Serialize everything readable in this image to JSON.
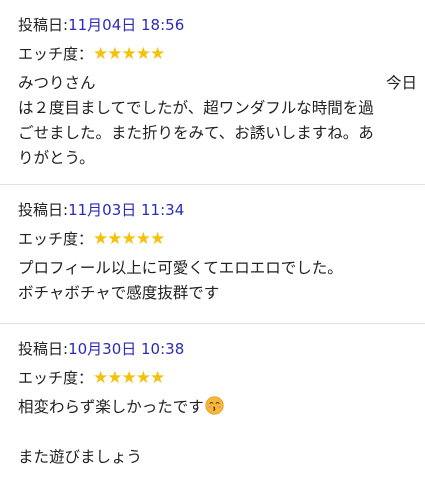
{
  "reviews": [
    {
      "posted_label": "投稿日:",
      "posted_date": "11月04日 18:56",
      "rating_label": "エッチ度：",
      "rating_stars": "★★★★★",
      "rating_value": 5,
      "rating_max": 5,
      "name": "みつりさん",
      "first_word": "今日",
      "lines": [
        "は２度目ましてでしたが、超ワンダフルな時間を過",
        "ごせました。また折りをみて、お誘いしますね。あ",
        "りがとう。"
      ]
    },
    {
      "posted_label": "投稿日:",
      "posted_date": "11月03日 11:34",
      "rating_label": "エッチ度：",
      "rating_stars": "★★★★★",
      "rating_value": 5,
      "rating_max": 5,
      "lines": [
        "プロフィール以上に可愛くてエロエロでした。",
        "ボチャボチャで感度抜群です"
      ]
    },
    {
      "posted_label": "投稿日:",
      "posted_date": "10月30日 10:38",
      "rating_label": "エッチ度：",
      "rating_stars": "★★★★★",
      "rating_value": 5,
      "rating_max": 5,
      "lines": [
        "相変わらず楽しかったです",
        "また遊びましょう"
      ],
      "emoji": "kissing-face-icon"
    }
  ],
  "colors": {
    "date": "#2b2bb8",
    "stars": "#f4c20d",
    "divider": "#e2e2e2",
    "text": "#222222"
  }
}
